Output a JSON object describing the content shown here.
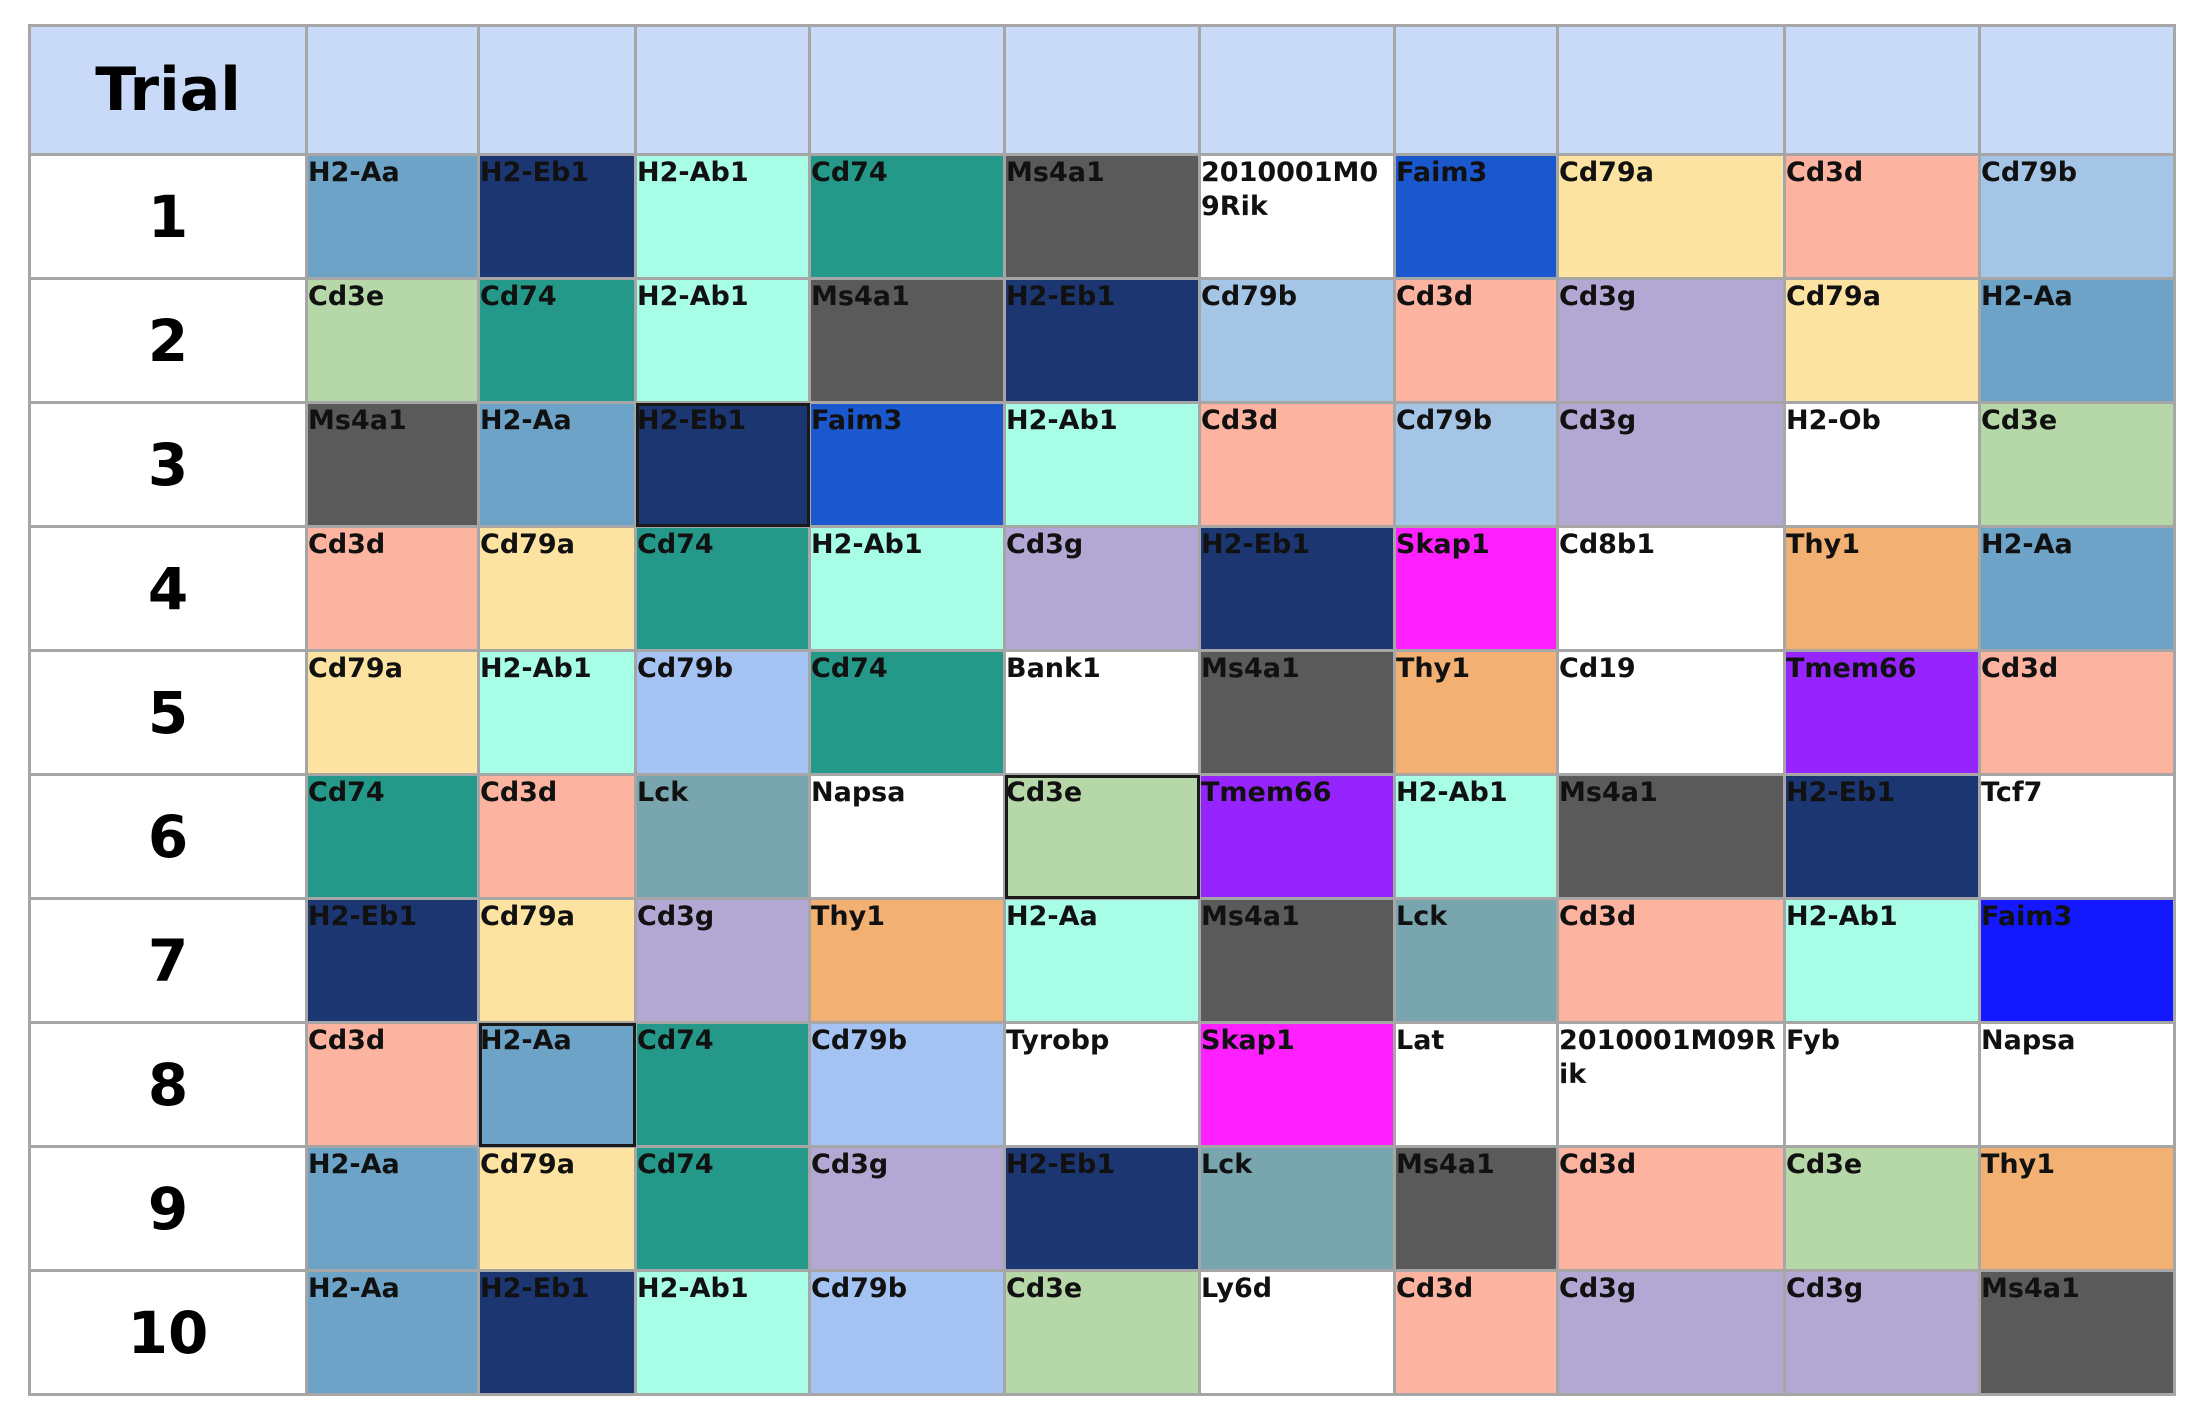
{
  "header": {
    "trial_label": "Trial"
  },
  "colors": {
    "header_bg": "#c9daf8",
    "H2-Aa": "#6ca3c7",
    "H2-Eb1": "#1c3672",
    "H2-Ab1": "#a7fde6",
    "Cd74": "#24998a",
    "Ms4a1": "#5a5a5a",
    "Faim3": "#1b58cd",
    "Cd79a": "#fde3a1",
    "Cd3d": "#fcb4a0",
    "Cd79b": "#a4c5e6",
    "Cd3e": "#b6d7a8",
    "Cd3g": "#b3a7d4",
    "Thy1": "#f3b073",
    "Skap1": "#ff20ff",
    "Tmem66": "#9524fe",
    "Lck": "#79a6ae",
    "white": "#ffffff"
  },
  "rows": [
    {
      "trial": "1",
      "cells": [
        {
          "text": "H2-Aa",
          "color": "#6ca3c7"
        },
        {
          "text": "H2-Eb1",
          "color": "#1c3672"
        },
        {
          "text": "H2-Ab1",
          "color": "#a7fde6"
        },
        {
          "text": "Cd74",
          "color": "#24998a"
        },
        {
          "text": "Ms4a1",
          "color": "#5a5a5a"
        },
        {
          "text": "2010001M09Rik",
          "color": "#ffffff"
        },
        {
          "text": "Faim3",
          "color": "#1b58cd"
        },
        {
          "text": "Cd79a",
          "color": "#fde3a1"
        },
        {
          "text": "Cd3d",
          "color": "#fcb4a0"
        },
        {
          "text": "Cd79b",
          "color": "#a4c5e6"
        }
      ]
    },
    {
      "trial": "2",
      "cells": [
        {
          "text": "Cd3e",
          "color": "#b6d7a8"
        },
        {
          "text": "Cd74",
          "color": "#24998a"
        },
        {
          "text": "H2-Ab1",
          "color": "#a7fde6"
        },
        {
          "text": "Ms4a1",
          "color": "#5a5a5a"
        },
        {
          "text": "H2-Eb1",
          "color": "#1c3672"
        },
        {
          "text": "Cd79b",
          "color": "#a4c5e6"
        },
        {
          "text": "Cd3d",
          "color": "#fcb4a0"
        },
        {
          "text": "Cd3g",
          "color": "#b3a7d4"
        },
        {
          "text": "Cd79a",
          "color": "#fde3a1"
        },
        {
          "text": "H2-Aa",
          "color": "#6ca3c7"
        }
      ]
    },
    {
      "trial": "3",
      "cells": [
        {
          "text": "Ms4a1",
          "color": "#5a5a5a"
        },
        {
          "text": "H2-Aa",
          "color": "#6ca3c7"
        },
        {
          "text": "H2-Eb1",
          "color": "#1c3672",
          "selected": true
        },
        {
          "text": "Faim3",
          "color": "#1b58cd"
        },
        {
          "text": "H2-Ab1",
          "color": "#a7fde6"
        },
        {
          "text": "Cd3d",
          "color": "#fcb4a0"
        },
        {
          "text": "Cd79b",
          "color": "#a4c5e6"
        },
        {
          "text": "Cd3g",
          "color": "#b3a7d4"
        },
        {
          "text": "H2-Ob",
          "color": "#ffffff"
        },
        {
          "text": "Cd3e",
          "color": "#b6d7a8"
        }
      ]
    },
    {
      "trial": "4",
      "cells": [
        {
          "text": "Cd3d",
          "color": "#fcb4a0"
        },
        {
          "text": "Cd79a",
          "color": "#fde3a1"
        },
        {
          "text": "Cd74",
          "color": "#24998a"
        },
        {
          "text": "H2-Ab1",
          "color": "#a7fde6"
        },
        {
          "text": "Cd3g",
          "color": "#b3a7d4"
        },
        {
          "text": "H2-Eb1",
          "color": "#1c3672"
        },
        {
          "text": "Skap1",
          "color": "#ff20ff"
        },
        {
          "text": "Cd8b1",
          "color": "#ffffff"
        },
        {
          "text": "Thy1",
          "color": "#f3b073"
        },
        {
          "text": "H2-Aa",
          "color": "#6ca3c7"
        }
      ]
    },
    {
      "trial": "5",
      "cells": [
        {
          "text": "Cd79a",
          "color": "#fde3a1"
        },
        {
          "text": "H2-Ab1",
          "color": "#a7fde6"
        },
        {
          "text": "Cd79b",
          "color": "#a4c3f3"
        },
        {
          "text": "Cd74",
          "color": "#24998a"
        },
        {
          "text": "Bank1",
          "color": "#ffffff"
        },
        {
          "text": "Ms4a1",
          "color": "#5a5a5a"
        },
        {
          "text": "Thy1",
          "color": "#f3b073"
        },
        {
          "text": "Cd19",
          "color": "#ffffff"
        },
        {
          "text": "Tmem66",
          "color": "#9524fe"
        },
        {
          "text": "Cd3d",
          "color": "#fcb4a0"
        }
      ]
    },
    {
      "trial": "6",
      "cells": [
        {
          "text": "Cd74",
          "color": "#24998a"
        },
        {
          "text": "Cd3d",
          "color": "#fcb4a0"
        },
        {
          "text": "Lck",
          "color": "#79a6ae"
        },
        {
          "text": "Napsa",
          "color": "#ffffff"
        },
        {
          "text": "Cd3e",
          "color": "#b6d7a8",
          "selected": true
        },
        {
          "text": "Tmem66",
          "color": "#9524fe"
        },
        {
          "text": "H2-Ab1",
          "color": "#a7fde6"
        },
        {
          "text": "Ms4a1",
          "color": "#5a5a5a"
        },
        {
          "text": "H2-Eb1",
          "color": "#1c3672"
        },
        {
          "text": "Tcf7",
          "color": "#ffffff"
        }
      ]
    },
    {
      "trial": "7",
      "cells": [
        {
          "text": "H2-Eb1",
          "color": "#1c3672"
        },
        {
          "text": "Cd79a",
          "color": "#fde3a1"
        },
        {
          "text": "Cd3g",
          "color": "#b3a7d4"
        },
        {
          "text": "Thy1",
          "color": "#f3b073"
        },
        {
          "text": "H2-Aa",
          "color": "#a7fde6"
        },
        {
          "text": "Ms4a1",
          "color": "#5a5a5a"
        },
        {
          "text": "Lck",
          "color": "#79a6ae"
        },
        {
          "text": "Cd3d",
          "color": "#fcb4a0"
        },
        {
          "text": "H2-Ab1",
          "color": "#a7fde6"
        },
        {
          "text": "Faim3",
          "color": "#1318ff"
        }
      ]
    },
    {
      "trial": "8",
      "cells": [
        {
          "text": "Cd3d",
          "color": "#fcb4a0"
        },
        {
          "text": "H2-Aa",
          "color": "#6ca3c7",
          "selected": true
        },
        {
          "text": "Cd74",
          "color": "#24998a"
        },
        {
          "text": "Cd79b",
          "color": "#a4c3f3"
        },
        {
          "text": "Tyrobp",
          "color": "#ffffff"
        },
        {
          "text": "Skap1",
          "color": "#ff20ff"
        },
        {
          "text": "Lat",
          "color": "#ffffff"
        },
        {
          "text": "2010001M09Rik",
          "color": "#ffffff"
        },
        {
          "text": "Fyb",
          "color": "#ffffff"
        },
        {
          "text": "Napsa",
          "color": "#ffffff"
        }
      ]
    },
    {
      "trial": "9",
      "cells": [
        {
          "text": "H2-Aa",
          "color": "#6ca3c7"
        },
        {
          "text": "Cd79a",
          "color": "#fde3a1"
        },
        {
          "text": "Cd74",
          "color": "#24998a"
        },
        {
          "text": "Cd3g",
          "color": "#b3a7d4"
        },
        {
          "text": "H2-Eb1",
          "color": "#1c3672"
        },
        {
          "text": "Lck",
          "color": "#79a6ae"
        },
        {
          "text": "Ms4a1",
          "color": "#5a5a5a"
        },
        {
          "text": "Cd3d",
          "color": "#fcb4a0"
        },
        {
          "text": "Cd3e",
          "color": "#b6d7a8"
        },
        {
          "text": "Thy1",
          "color": "#f3b073"
        }
      ]
    },
    {
      "trial": "10",
      "cells": [
        {
          "text": "H2-Aa",
          "color": "#6ca3c7"
        },
        {
          "text": "H2-Eb1",
          "color": "#1c3672"
        },
        {
          "text": "H2-Ab1",
          "color": "#a7fde6"
        },
        {
          "text": "Cd79b",
          "color": "#a4c3f3"
        },
        {
          "text": "Cd3e",
          "color": "#b6d7a8"
        },
        {
          "text": "Ly6d",
          "color": "#ffffff"
        },
        {
          "text": "Cd3d",
          "color": "#fcb4a0"
        },
        {
          "text": "Cd3g",
          "color": "#b3a7d4"
        },
        {
          "text": "Cd3g",
          "color": "#b3a7d4"
        },
        {
          "text": "Ms4a1",
          "color": "#5a5a5a"
        }
      ]
    }
  ]
}
